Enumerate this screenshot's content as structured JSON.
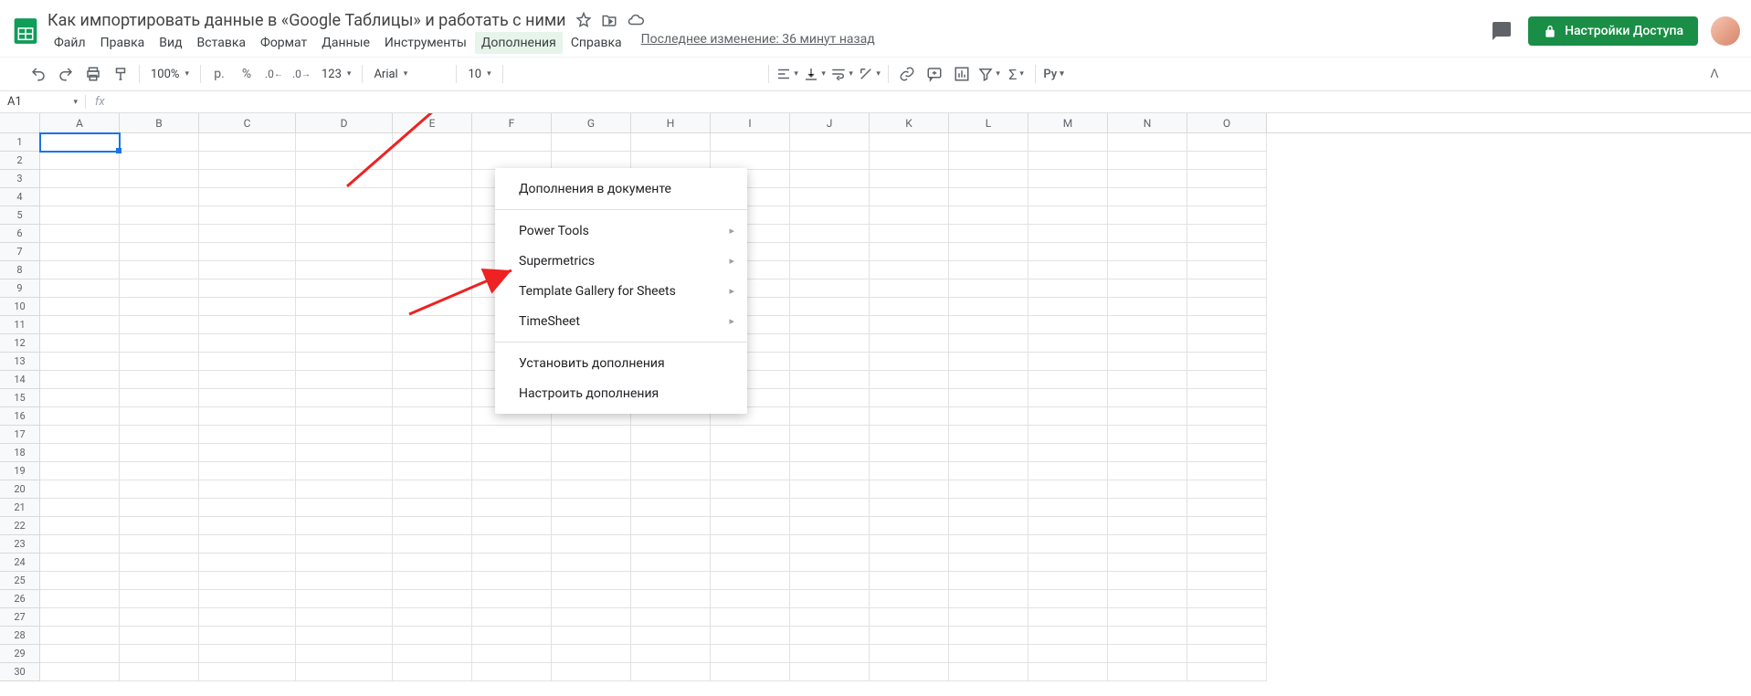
{
  "header": {
    "title": "Как импортировать данные в «Google Таблицы» и работать с ними",
    "last_edit": "Последнее изменение: 36 минут назад",
    "share_label": "Настройки Доступа"
  },
  "menubar": [
    "Файл",
    "Правка",
    "Вид",
    "Вставка",
    "Формат",
    "Данные",
    "Инструменты",
    "Дополнения",
    "Справка"
  ],
  "toolbar": {
    "zoom": "100%",
    "font_name": "Arial",
    "font_size": "10",
    "number_format_more": "123",
    "script_tag": "Ру"
  },
  "name_box": "A1",
  "formula_fx": "fx",
  "columns": [
    "A",
    "B",
    "C",
    "D",
    "E",
    "F",
    "G",
    "H",
    "I",
    "J",
    "K",
    "L",
    "M",
    "N",
    "O"
  ],
  "row_count": 30,
  "addons_menu": {
    "document": "Дополнения в документе",
    "items": [
      "Power Tools",
      "Supermetrics",
      "Template Gallery for Sheets",
      "TimeSheet"
    ],
    "install": "Установить дополнения",
    "manage": "Настроить дополнения"
  }
}
